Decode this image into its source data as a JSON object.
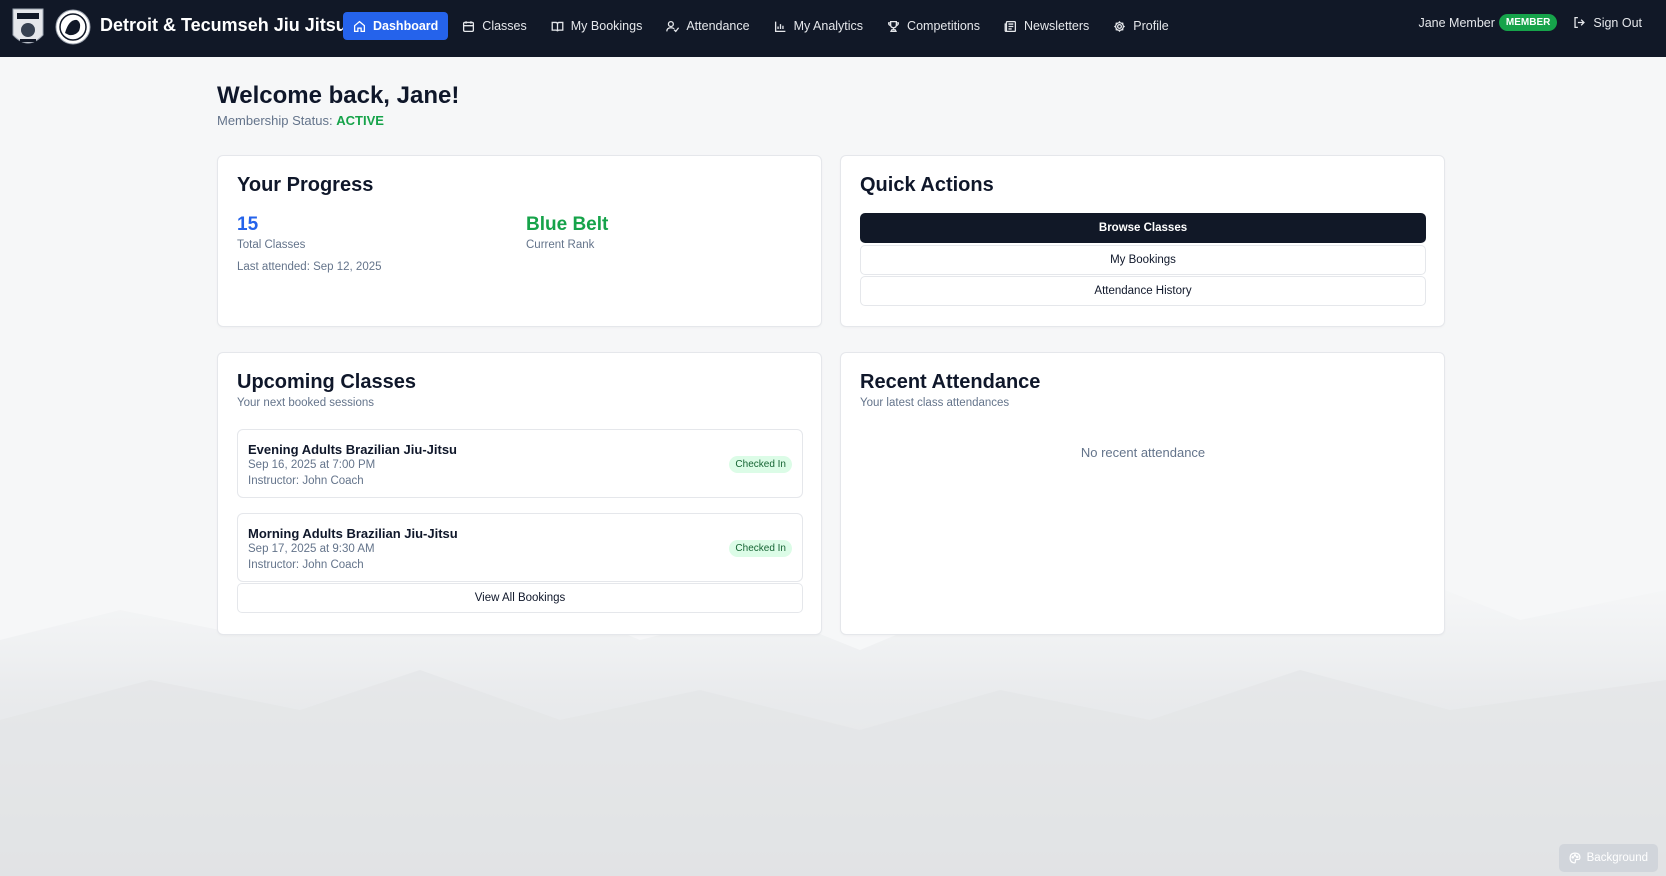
{
  "brand": {
    "name": "Detroit & Tecumseh Jiu Jitsu"
  },
  "nav": {
    "items": [
      {
        "label": "Dashboard",
        "icon": "home-icon",
        "active": true
      },
      {
        "label": "Classes",
        "icon": "calendar-icon"
      },
      {
        "label": "My Bookings",
        "icon": "book-icon"
      },
      {
        "label": "Attendance",
        "icon": "user-check-icon"
      },
      {
        "label": "My Analytics",
        "icon": "bar-chart-icon"
      },
      {
        "label": "Competitions",
        "icon": "trophy-icon"
      },
      {
        "label": "Newsletters",
        "icon": "newspaper-icon"
      },
      {
        "label": "Profile",
        "icon": "gear-icon"
      }
    ],
    "user_name": "Jane Member",
    "role_badge": "MEMBER",
    "sign_out": "Sign Out"
  },
  "welcome": {
    "title": "Welcome back, Jane!",
    "membership_label": "Membership Status:",
    "membership_status": "ACTIVE"
  },
  "progress": {
    "title": "Your Progress",
    "total_classes": "15",
    "total_classes_label": "Total Classes",
    "rank": "Blue Belt",
    "rank_label": "Current Rank",
    "last_attended": "Last attended: Sep 12, 2025"
  },
  "quick_actions": {
    "title": "Quick Actions",
    "browse": "Browse Classes",
    "bookings": "My Bookings",
    "history": "Attendance History"
  },
  "upcoming": {
    "title": "Upcoming Classes",
    "subtitle": "Your next booked sessions",
    "items": [
      {
        "name": "Evening Adults Brazilian Jiu-Jitsu",
        "time": "Sep 16, 2025 at 7:00 PM",
        "instructor": "Instructor: John Coach",
        "status": "Checked In"
      },
      {
        "name": "Morning Adults Brazilian Jiu-Jitsu",
        "time": "Sep 17, 2025 at 9:30 AM",
        "instructor": "Instructor: John Coach",
        "status": "Checked In"
      }
    ],
    "view_all": "View All Bookings"
  },
  "recent": {
    "title": "Recent Attendance",
    "subtitle": "Your latest class attendances",
    "empty": "No recent attendance"
  },
  "background_button": "Background",
  "colors": {
    "nav_bg": "#111827",
    "accent": "#2563eb",
    "success": "#16a34a"
  }
}
